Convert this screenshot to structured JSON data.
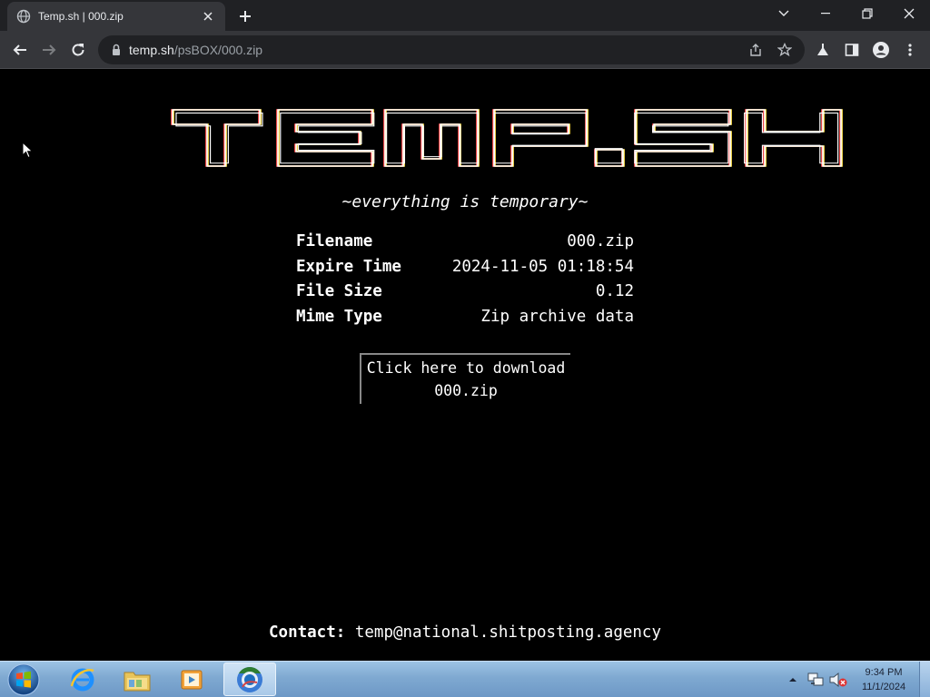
{
  "browser": {
    "tab_title": "Temp.sh | 000.zip",
    "url_host": "temp.sh",
    "url_path": "/psBOX/000.zip"
  },
  "page": {
    "logo_text": "TEMP.SH",
    "tagline": "~everything is temporary~",
    "file_info": [
      {
        "label": "Filename",
        "value": "000.zip"
      },
      {
        "label": "Expire Time",
        "value": "2024-11-05 01:18:54"
      },
      {
        "label": "File Size",
        "value": "0.12"
      },
      {
        "label": "Mime Type",
        "value": "Zip archive data"
      }
    ],
    "download_line1": "Click here to download",
    "download_line2": "000.zip",
    "contact_label": "Contact:",
    "contact_email": "temp@national.shitposting.agency"
  },
  "taskbar": {
    "time": "9:34 PM",
    "date": "11/1/2024",
    "apps": [
      "internet-explorer",
      "windows-explorer",
      "media-player",
      "chrome"
    ]
  }
}
